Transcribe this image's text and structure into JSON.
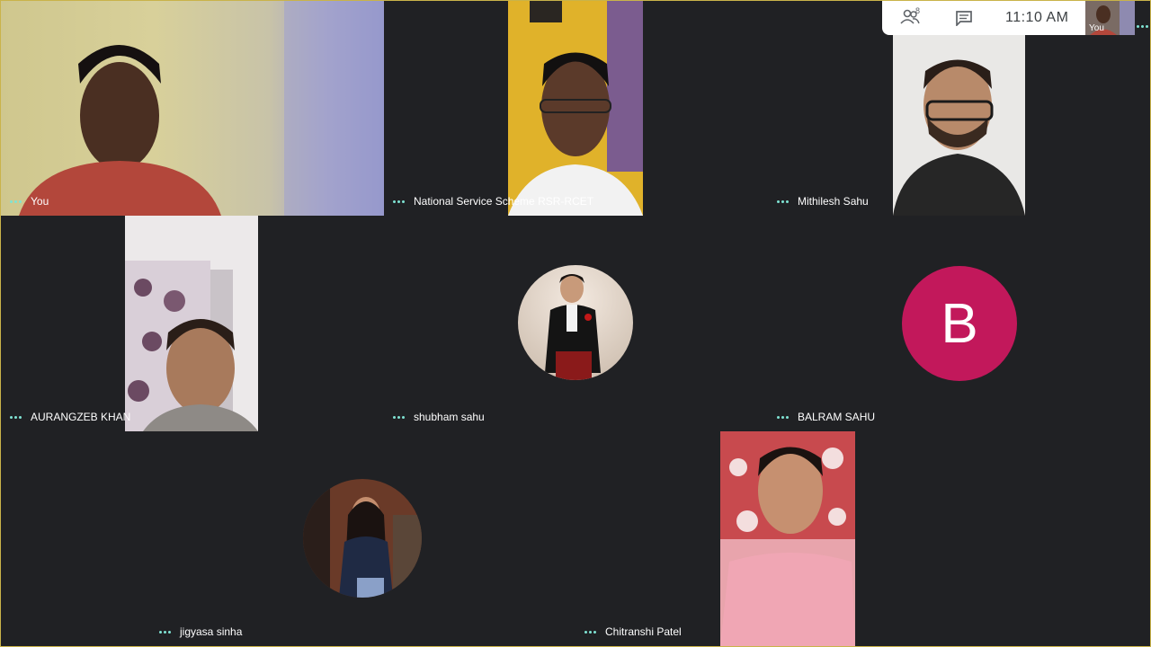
{
  "header": {
    "participants_count": "8",
    "time": "11:10 AM",
    "self_thumb_label": "You",
    "people_icon": "people-icon",
    "chat_icon": "chat-icon"
  },
  "participants": [
    {
      "name": "You",
      "type": "video"
    },
    {
      "name": "National Service Scheme RSR-RCET",
      "type": "video"
    },
    {
      "name": "Mithilesh Sahu",
      "type": "video"
    },
    {
      "name": "AURANGZEB KHAN",
      "type": "video"
    },
    {
      "name": "shubham sahu",
      "type": "avatar-photo"
    },
    {
      "name": "BALRAM SAHU",
      "type": "avatar-initial",
      "initial": "B"
    },
    {
      "name": "jigyasa sinha",
      "type": "avatar-photo"
    },
    {
      "name": "Chitranshi Patel",
      "type": "video"
    }
  ],
  "colors": {
    "background": "#202124",
    "tile_dots": "#7fe3d3",
    "avatar_b": "#c2185b",
    "frame_border": "#c9b34a"
  }
}
